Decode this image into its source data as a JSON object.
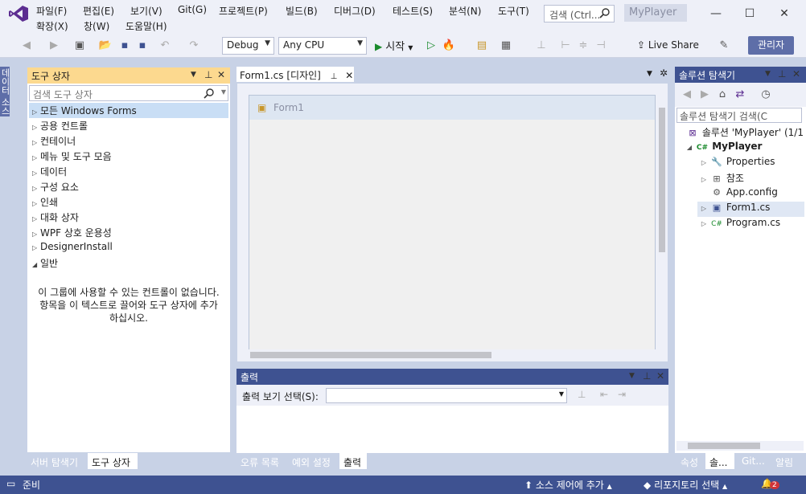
{
  "menu": {
    "row1": [
      "파일(F)",
      "편집(E)",
      "보기(V)",
      "Git(G)",
      "프로젝트(P)",
      "빌드(B)",
      "디버그(D)",
      "테스트(S)",
      "분석(N)",
      "도구(T)"
    ],
    "row2": [
      "확장(X)",
      "창(W)",
      "도움말(H)"
    ]
  },
  "search": {
    "placeholder": "검색 (Ctrl..."
  },
  "title": {
    "project": "MyPlayer"
  },
  "window_buttons": {
    "minimize": "—",
    "maximize": "☐",
    "close": "✕"
  },
  "toolbar": {
    "config": "Debug",
    "platform": "Any CPU",
    "start_label": "시작",
    "liveshare": "Live Share",
    "admin": "관리자"
  },
  "left_vtab": {
    "label": "데이터 소스"
  },
  "toolbox": {
    "header": "도구 상자",
    "search_placeholder": "검색 도구 상자",
    "categories": [
      "모든 Windows Forms",
      "공용 컨트롤",
      "컨테이너",
      "메뉴 및 도구 모음",
      "데이터",
      "구성 요소",
      "인쇄",
      "대화 상자",
      "WPF 상호 운용성",
      "DesignerInstall",
      "일반"
    ],
    "empty_message": "이 그룹에 사용할 수 있는 컨트롤이 없습니다. 항목을 이 텍스트로 끌어와 도구 상자에 추가하십시오.",
    "tabs": [
      "서버 탐색기",
      "도구 상자"
    ]
  },
  "designer": {
    "tab_label": "Form1.cs [디자인]",
    "form_title": "Form1"
  },
  "output": {
    "header": "출력",
    "show_output_label": "출력 보기 선택(S):",
    "tabs": [
      "오류 목록",
      "예외 설정",
      "출력"
    ]
  },
  "solution_explorer": {
    "header": "솔루션 탐색기",
    "search_placeholder": "솔루션 탐색기 검색(C",
    "solution": "솔루션 'MyPlayer' (1/1",
    "project": "MyPlayer",
    "items": [
      "Properties",
      "참조",
      "App.config",
      "Form1.cs",
      "Program.cs"
    ],
    "tabs": [
      "속성",
      "솔...",
      "Git...",
      "알림"
    ]
  },
  "status": {
    "ready": "준비",
    "source_control": "소스 제어에 추가",
    "repository": "리포지토리 선택",
    "notification_count": "2"
  }
}
